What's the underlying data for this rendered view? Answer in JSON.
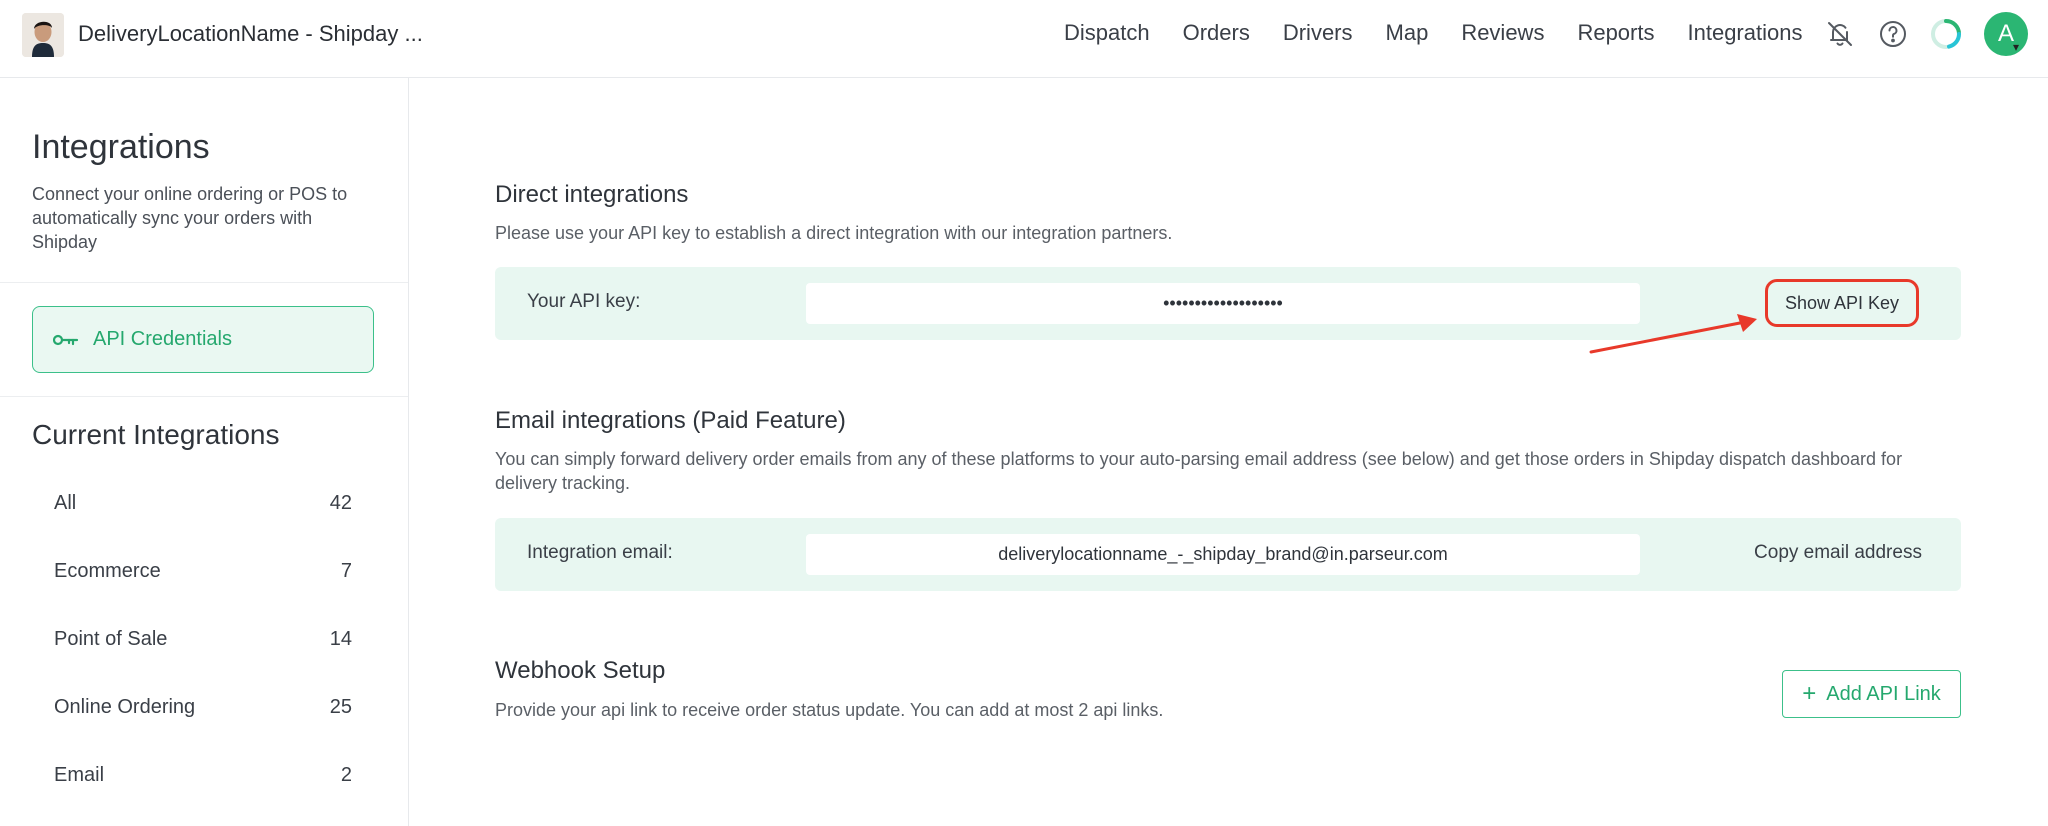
{
  "app": {
    "brand_name": "DeliveryLocationName - Shipday ...",
    "user_initial": "A"
  },
  "nav": {
    "items": [
      "Dispatch",
      "Orders",
      "Drivers",
      "Map",
      "Reviews",
      "Reports",
      "Integrations"
    ]
  },
  "icons": {
    "notifications_off": "bell-off-icon",
    "help": "question-circle-icon",
    "status": "loading-ring-icon",
    "api_credentials": "key-icon"
  },
  "sidebar": {
    "title": "Integrations",
    "description": "Connect your online ordering or POS to automatically sync your orders with Shipday",
    "api_credentials_label": "API Credentials",
    "current_title": "Current Integrations",
    "categories": [
      {
        "label": "All",
        "count": "42"
      },
      {
        "label": "Ecommerce",
        "count": "7"
      },
      {
        "label": "Point of Sale",
        "count": "14"
      },
      {
        "label": "Online Ordering",
        "count": "25"
      },
      {
        "label": "Email",
        "count": "2"
      }
    ]
  },
  "direct": {
    "title": "Direct integrations",
    "description": "Please use your API key to establish a direct integration with our integration partners.",
    "label": "Your API key:",
    "masked_key": "•••••••••••••••••••",
    "button": "Show API Key"
  },
  "email": {
    "title": "Email integrations (Paid Feature)",
    "description": "You can simply forward delivery order emails from any of these platforms to your auto-parsing email address (see below) and get those orders in Shipday dispatch dashboard for delivery tracking.",
    "label": "Integration email:",
    "address": "deliverylocationname_-_shipday_brand@in.parseur.com",
    "button": "Copy email address"
  },
  "webhook": {
    "title": "Webhook Setup",
    "description": "Provide your api link to receive order status update. You can add at most 2 api links.",
    "button": "Add API Link"
  },
  "colors": {
    "accent": "#25a86e",
    "panel_bg": "#e8f7f1",
    "highlight": "#e8392a"
  }
}
